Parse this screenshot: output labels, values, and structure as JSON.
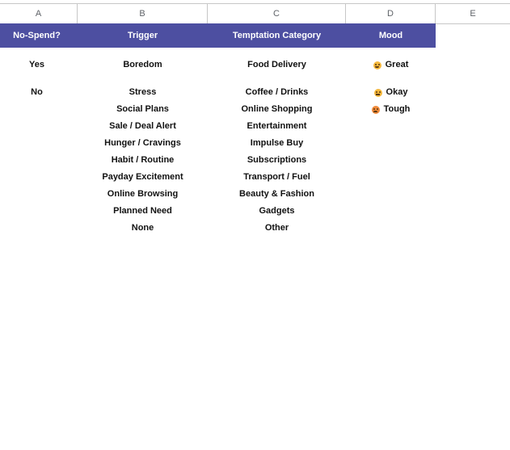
{
  "columns": [
    "A",
    "B",
    "C",
    "D",
    "E"
  ],
  "headers": {
    "no_spend": "No-Spend?",
    "trigger": "Trigger",
    "category": "Temptation Category",
    "mood": "Mood"
  },
  "colors": {
    "header_bg": "#4d4fa1",
    "header_text": "#ffffff"
  },
  "no_spend": [
    "Yes",
    "No"
  ],
  "triggers": [
    "Boredom",
    "Stress",
    "Social Plans",
    "Sale / Deal Alert",
    "Hunger / Cravings",
    "Habit / Routine",
    "Payday Excitement",
    "Online Browsing",
    "Planned Need",
    "None"
  ],
  "categories": [
    "Food Delivery",
    "Coffee / Drinks",
    "Online Shopping",
    "Entertainment",
    "Impulse Buy",
    "Subscriptions",
    "Transport / Fuel",
    "Beauty & Fashion",
    "Gadgets",
    "Other"
  ],
  "moods": [
    {
      "label": "Great",
      "icon": "smiling-face-icon",
      "color": "#f5b83d"
    },
    {
      "label": "Okay",
      "icon": "neutral-face-icon",
      "color": "#f5b83d"
    },
    {
      "label": "Tough",
      "icon": "sad-face-icon",
      "color": "#f08a3a"
    }
  ]
}
